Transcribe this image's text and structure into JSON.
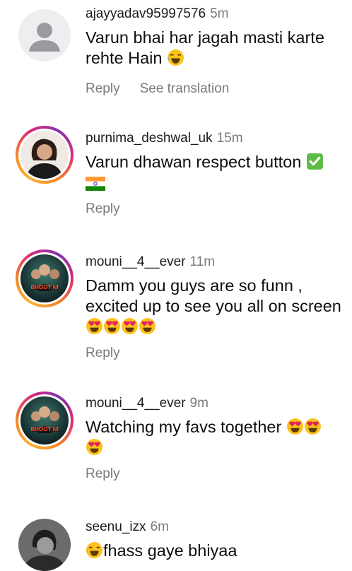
{
  "comments": [
    {
      "username": "ajayyadav95997576",
      "time": "5m",
      "text": "Varun bhai har jagah masti karte rehte Hain",
      "emojis": [
        "😂"
      ],
      "reply": "Reply",
      "translate": "See translation"
    },
    {
      "username": "purnima_deshwal_uk",
      "time": "15m",
      "text": "Varun dhawan respect button",
      "emojis": [
        "✅",
        "🇮🇳"
      ],
      "reply": "Reply"
    },
    {
      "username": "mouni__4__ever",
      "time": "11m",
      "text": "Damm you guys are so funn , excited up to see you all on screen",
      "emojis": [
        "😍",
        "😍",
        "😍",
        "😍"
      ],
      "reply": "Reply",
      "avatar_text": "BHOOT NI"
    },
    {
      "username": "mouni__4__ever",
      "time": "9m",
      "text": "Watching my favs together",
      "emojis": [
        "😍",
        "😍",
        "😍"
      ],
      "reply": "Reply",
      "avatar_text": "BHOOT NI"
    },
    {
      "username": "seenu_izx",
      "time": "6m",
      "text": "fhass gaye bhiyaa",
      "emojis": [
        "😂"
      ]
    }
  ]
}
